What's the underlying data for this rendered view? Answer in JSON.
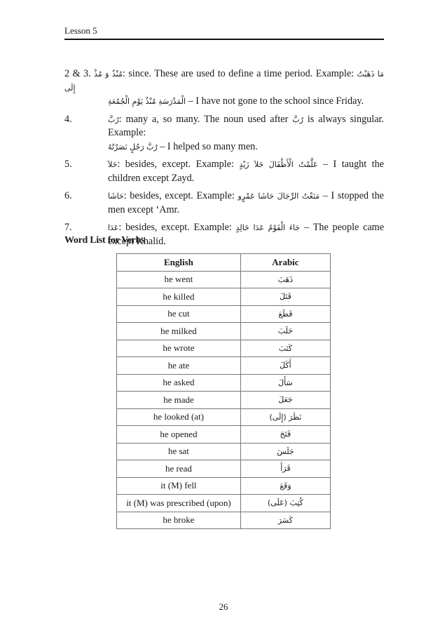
{
  "header": {
    "title": "Lesson 5"
  },
  "items": [
    {
      "number": "2 & 3.",
      "term": "مُنْذُ وَ مُذْ",
      "line1": ": since.  These are used to define a time period.  Example: ",
      "example_ar_part1": "مَا ذَهَبْتُ إِلَى",
      "example_ar_part2": "الْمَدْرَسَةِ مُنْذُ يَوْمِ الْجُمُعَةِ",
      "translation": " – I have not gone to the school since Friday."
    },
    {
      "number": "4.",
      "term": "رُبَّ",
      "text1": ": many a, so many.  The noun used after ",
      "term_inline": "رُبَّ",
      "text2": " is always singular.  Example: ",
      "example_ar": "رُبَّ رَجُلٍ نَصَرْتُهُ",
      "translation": " – I helped so many men."
    },
    {
      "number": "5.",
      "term": "خَلاَ",
      "text": ": besides, except.  Example: ",
      "example_ar": "عَلَّمْتُ الْأَطْفَالَ خَلاَ زَيْدٍ",
      "translation": " – I taught the children except Zayd."
    },
    {
      "number": "6.",
      "term": "حَاشَا",
      "text": ": besides, except.  Example: ",
      "example_ar": "مَنَعْتُ الرِّجَالَ حَاشَا عَمْرٍو",
      "translation": " – I stopped the men except ‘Amr."
    },
    {
      "number": "7.",
      "term": "عَدَا",
      "text": ": besides, except.  Example: ",
      "example_ar": "جَاءَ الْقَوْمُ عَدَا خَالِدٍ",
      "translation": " – The people came except Khalid."
    }
  ],
  "section": {
    "title": "Word List for Verbs"
  },
  "table": {
    "headers": [
      "English",
      "Arabic"
    ],
    "rows": [
      {
        "english": "he went",
        "arabic": "ذَهَبَ"
      },
      {
        "english": "he killed",
        "arabic": "قَتَلَ"
      },
      {
        "english": "he cut",
        "arabic": "قَطَعَ"
      },
      {
        "english": "he milked",
        "arabic": "حَلَبَ"
      },
      {
        "english": "he wrote",
        "arabic": "كَتَبَ"
      },
      {
        "english": "he ate",
        "arabic": "أَكَلَ"
      },
      {
        "english": "he asked",
        "arabic": "سَأَلَ"
      },
      {
        "english": "he made",
        "arabic": "جَعَلَ"
      },
      {
        "english": "he looked (at)",
        "arabic": "نَظَرَ (إِلَى)"
      },
      {
        "english": "he opened",
        "arabic": "فَتَحَ"
      },
      {
        "english": "he sat",
        "arabic": "جَلَسَ"
      },
      {
        "english": "he read",
        "arabic": "قَرَأَ"
      },
      {
        "english": "it (M) fell",
        "arabic": "وَقَعَ"
      },
      {
        "english": "it (M) was prescribed (upon)",
        "arabic": "كُتِبَ (عَلَى)"
      },
      {
        "english": "he broke",
        "arabic": "كَسَرَ"
      }
    ]
  },
  "footer": {
    "page_number": "26"
  }
}
